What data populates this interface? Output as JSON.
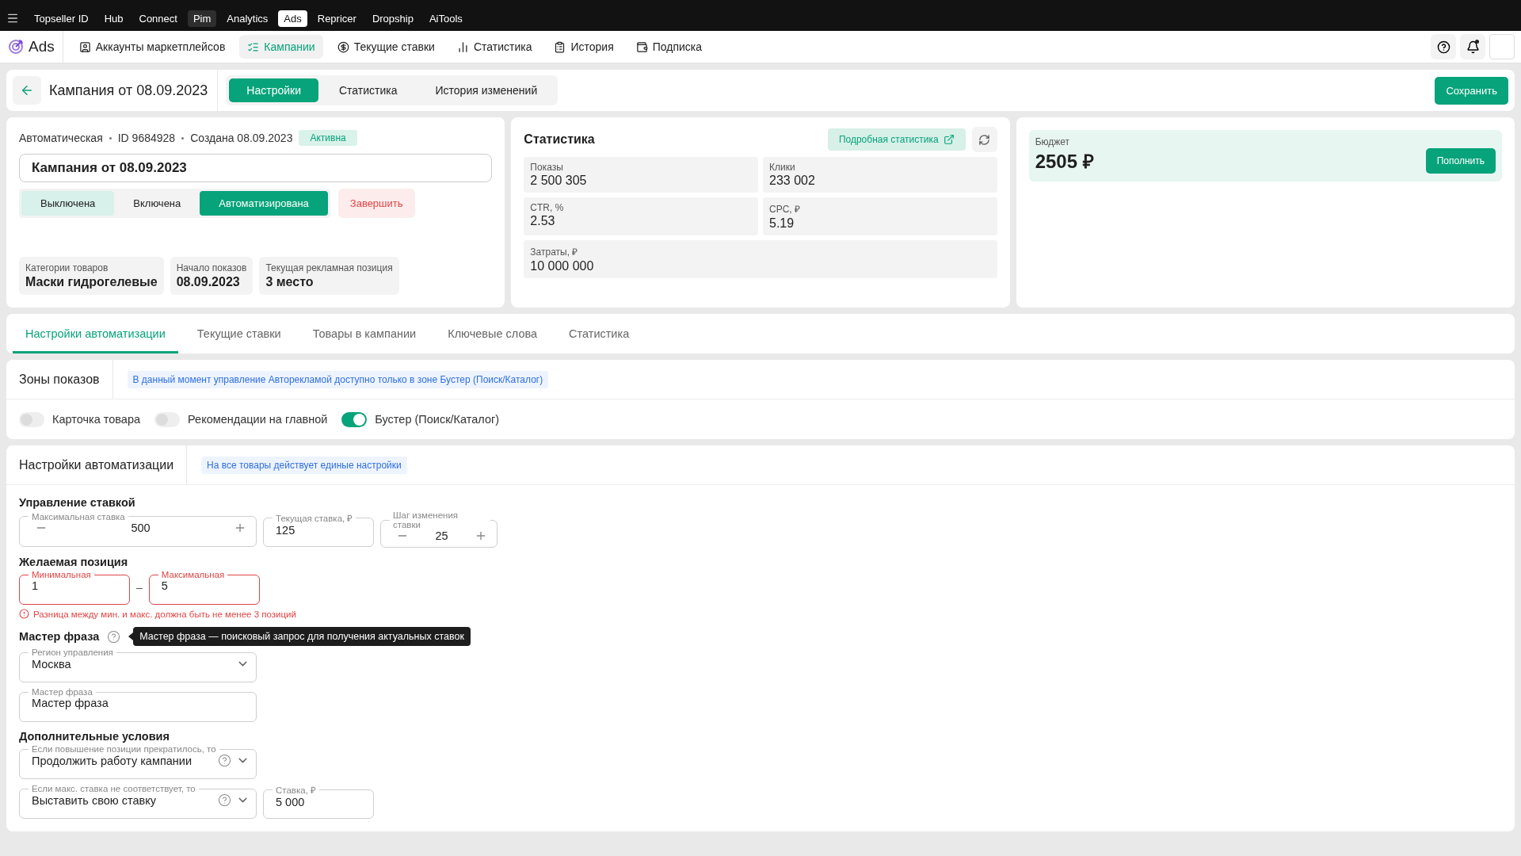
{
  "top_menu": [
    {
      "label": "Topseller ID",
      "selected": false,
      "hovered": false
    },
    {
      "label": "Hub",
      "selected": false,
      "hovered": false
    },
    {
      "label": "Connect",
      "selected": false,
      "hovered": false
    },
    {
      "label": "Pim",
      "selected": false,
      "hovered": true
    },
    {
      "label": "Analytics",
      "selected": false,
      "hovered": false
    },
    {
      "label": "Ads",
      "selected": true,
      "hovered": false
    },
    {
      "label": "Repricer",
      "selected": false,
      "hovered": false
    },
    {
      "label": "Dropship",
      "selected": false,
      "hovered": false
    },
    {
      "label": "AiTools",
      "selected": false,
      "hovered": false
    }
  ],
  "app": {
    "name": "Ads"
  },
  "nav": [
    {
      "label": "Аккаунты маркетплейсов",
      "selected": false
    },
    {
      "label": "Кампании",
      "selected": true
    },
    {
      "label": "Текущие ставки",
      "selected": false
    },
    {
      "label": "Статистика",
      "selected": false
    },
    {
      "label": "История",
      "selected": false
    },
    {
      "label": "Подписка",
      "selected": false
    }
  ],
  "header": {
    "title": "Кампания от 08.09.2023",
    "tabs": [
      {
        "label": "Настройки",
        "selected": true
      },
      {
        "label": "Статистика",
        "selected": false
      },
      {
        "label": "История изменений",
        "selected": false
      }
    ],
    "save_button": "Сохранить"
  },
  "campaign": {
    "meta": [
      "Автоматическая",
      "ID 9684928",
      "Создана 08.09.2023"
    ],
    "status": "Активна",
    "name": "Кампания от 08.09.2023",
    "modes": [
      {
        "label": "Выключена",
        "selected": false,
        "hovered": true
      },
      {
        "label": "Включена",
        "selected": false,
        "hovered": false
      },
      {
        "label": "Автоматизирована",
        "selected": true,
        "hovered": false
      }
    ],
    "finish_button": "Завершить",
    "info": [
      {
        "label": "Категории товаров",
        "value": "Маски гидрогелевые"
      },
      {
        "label": "Начало показов",
        "value": "08.09.2023"
      },
      {
        "label": "Текущая рекламная позиция",
        "value": "3 место"
      }
    ]
  },
  "stats": {
    "title": "Статистика",
    "detail_button": "Подробная статистика",
    "tiles": [
      {
        "label": "Показы",
        "value": "2 500 305"
      },
      {
        "label": "Клики",
        "value": "233 002"
      },
      {
        "label": "CTR, %",
        "value": "2.53"
      },
      {
        "label": "CPC, ₽",
        "value": "5.19"
      },
      {
        "label": "Затраты, ₽",
        "value": "10 000 000"
      }
    ]
  },
  "budget": {
    "label": "Бюджет",
    "amount": "2505 ₽",
    "button": "Пополнить"
  },
  "section_tabs": [
    {
      "label": "Настройки автоматизации",
      "selected": true
    },
    {
      "label": "Текущие ставки",
      "selected": false
    },
    {
      "label": "Товары в кампании",
      "selected": false
    },
    {
      "label": "Ключевые слова",
      "selected": false
    },
    {
      "label": "Статистика",
      "selected": false
    }
  ],
  "zones": {
    "title": "Зоны показов",
    "note": "В данный момент управление Авторекламой доступно только в зоне Бустер (Поиск/Каталог)",
    "toggles": [
      {
        "label": "Карточка товара",
        "on": false
      },
      {
        "label": "Рекомендации на главной",
        "on": false
      },
      {
        "label": "Бустер (Поиск/Каталог)",
        "on": true
      }
    ]
  },
  "automation": {
    "title": "Настройки автоматизации",
    "note": "На все товары действует единые настройки",
    "groups": [
      {
        "title": "Управление ставкой",
        "rows": [
          [
            {
              "kind": "stepper",
              "label": "Максимальная ставка",
              "value": "500"
            },
            {
              "kind": "input",
              "label": "Текущая ставка, ₽",
              "value": "125"
            },
            {
              "kind": "stepper",
              "label": "Шаг изменения ставки",
              "value": "25"
            }
          ]
        ]
      },
      {
        "title": "Желаемая позиция",
        "separator": "–",
        "error": "Разница между мин. и макс. должна быть не менее 3 позиций",
        "rows": [
          [
            {
              "kind": "input",
              "label": "Минимальная",
              "value": "1",
              "invalid": true
            },
            {
              "kind": "input",
              "label": "Максимальная",
              "value": "5",
              "invalid": true
            }
          ]
        ]
      },
      {
        "title": "Мастер фраза",
        "tooltip": "Мастер фраза — поисковый запрос для получения актуальных ставок",
        "rows": [
          [
            {
              "kind": "select",
              "label": "Регион управления",
              "value": "Москва",
              "help": false
            }
          ],
          [
            {
              "kind": "input",
              "label": "Мастер фраза",
              "value": "Мастер фраза"
            }
          ]
        ]
      },
      {
        "title": "Дополнительные условия",
        "rows": [
          [
            {
              "kind": "select",
              "label": "Если повышение позиции прекратилось, то",
              "value": "Продолжить работу кампании",
              "help": true
            }
          ],
          [
            {
              "kind": "select",
              "label": "Если макс. ставка не соответствует, то",
              "value": "Выставить свою ставку",
              "help": true
            },
            {
              "kind": "input",
              "label": "Ставка, ₽",
              "value": "5 000"
            }
          ]
        ]
      }
    ]
  }
}
